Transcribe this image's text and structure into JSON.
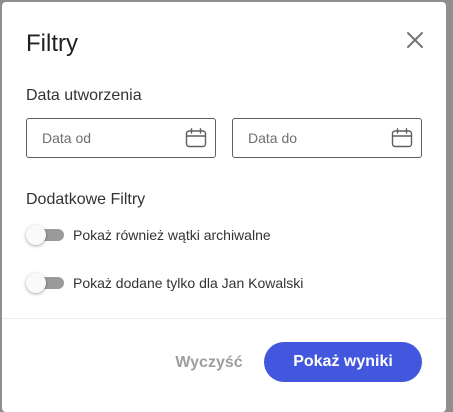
{
  "dialog": {
    "title": "Filtry",
    "close_icon": "close-icon"
  },
  "date_section": {
    "label": "Data utworzenia",
    "from": {
      "value": "",
      "placeholder": "Data od",
      "icon": "calendar-icon"
    },
    "to": {
      "value": "",
      "placeholder": "Data do",
      "icon": "calendar-icon"
    }
  },
  "extra_section": {
    "label": "Dodatkowe Filtry",
    "toggles": [
      {
        "label": "Pokaż również wątki archiwalne",
        "checked": false
      },
      {
        "label": "Pokaż dodane tylko dla Jan Kowalski",
        "checked": false
      }
    ]
  },
  "actions": {
    "clear_label": "Wyczyść",
    "submit_label": "Pokaż wyniki"
  },
  "colors": {
    "primary": "#4356de",
    "backdrop": "#8f8f8f",
    "toggle_track_off": "#9a9a9a",
    "clear_text": "#9e9e9e"
  }
}
